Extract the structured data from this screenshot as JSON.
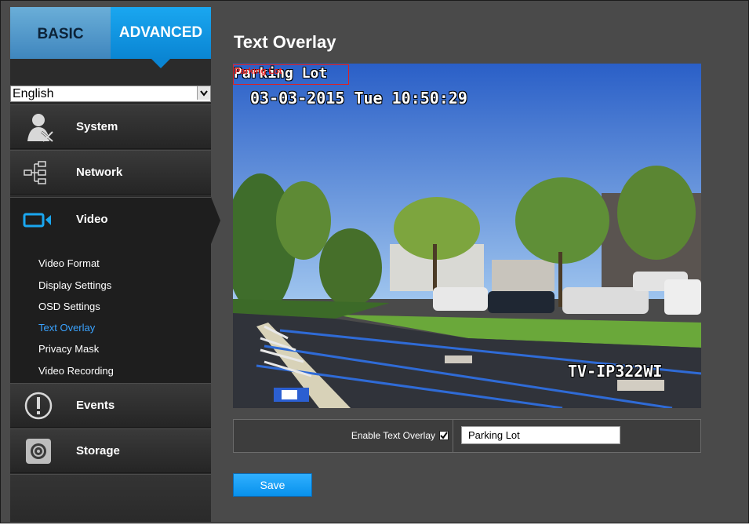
{
  "tabs": {
    "basic": "BASIC",
    "advanced": "ADVANCED"
  },
  "language": {
    "selected": "English"
  },
  "menu": {
    "system": "System",
    "network": "Network",
    "video": "Video",
    "video_sub": [
      "Video Format",
      "Display Settings",
      "OSD Settings",
      "Text Overlay",
      "Privacy Mask",
      "Video Recording"
    ],
    "events": "Events",
    "storage": "Storage"
  },
  "page": {
    "title": "Text Overlay"
  },
  "camera": {
    "overlay_text": "Parking Lot",
    "overlay_preview_text": "Parking Lot",
    "timestamp": "03-03-2015 Tue 10:50:29",
    "model": "TV-IP322WI"
  },
  "form": {
    "enable_label": "Enable Text Overlay",
    "enable_checked": true,
    "text_value": "Parking Lot"
  },
  "buttons": {
    "save": "Save"
  },
  "colors": {
    "accent": "#0a85d3",
    "active_link": "#3aa3ff",
    "background": "#4a4a4a"
  }
}
